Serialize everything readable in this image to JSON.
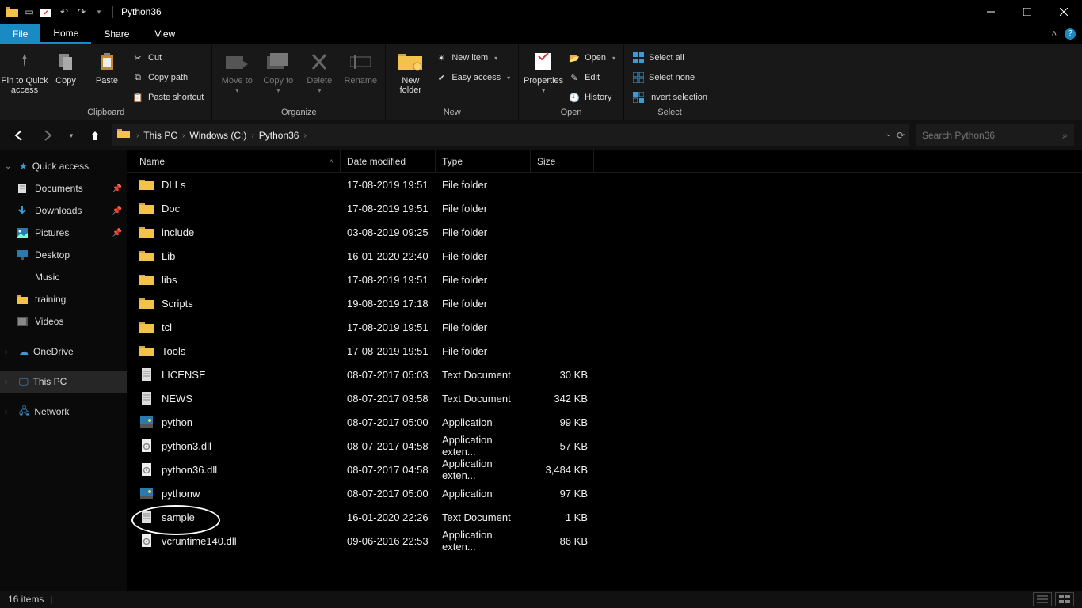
{
  "window": {
    "title": "Python36"
  },
  "menu": {
    "file": "File",
    "home": "Home",
    "share": "Share",
    "view": "View"
  },
  "ribbon": {
    "groups": {
      "clipboard": {
        "caption": "Clipboard",
        "pin": "Pin to Quick access",
        "copy": "Copy",
        "paste": "Paste",
        "cut": "Cut",
        "copypath": "Copy path",
        "pastesc": "Paste shortcut"
      },
      "organize": {
        "caption": "Organize",
        "moveto": "Move to",
        "copyto": "Copy to",
        "del": "Delete",
        "rename": "Rename"
      },
      "new": {
        "caption": "New",
        "newfolder": "New folder",
        "newitem": "New item",
        "easyaccess": "Easy access"
      },
      "open": {
        "caption": "Open",
        "properties": "Properties",
        "open": "Open",
        "edit": "Edit",
        "history": "History"
      },
      "select": {
        "caption": "Select",
        "all": "Select all",
        "none": "Select none",
        "invert": "Invert selection"
      }
    }
  },
  "breadcrumb": {
    "root": "This PC",
    "drive": "Windows (C:)",
    "folder": "Python36"
  },
  "search": {
    "placeholder": "Search Python36"
  },
  "columns": {
    "name": "Name",
    "date": "Date modified",
    "type": "Type",
    "size": "Size"
  },
  "sidebar": {
    "quick": {
      "label": "Quick access"
    },
    "items": [
      {
        "label": "Documents",
        "pinned": true,
        "icon": "doc"
      },
      {
        "label": "Downloads",
        "pinned": true,
        "icon": "down"
      },
      {
        "label": "Pictures",
        "pinned": true,
        "icon": "pic"
      },
      {
        "label": "Desktop",
        "pinned": false,
        "icon": "desk"
      },
      {
        "label": "Music",
        "pinned": false,
        "icon": "music"
      },
      {
        "label": "training",
        "pinned": false,
        "icon": "fold"
      },
      {
        "label": "Videos",
        "pinned": false,
        "icon": "vid"
      }
    ],
    "onedrive": "OneDrive",
    "thispc": "This PC",
    "network": "Network"
  },
  "files": [
    {
      "name": "DLLs",
      "date": "17-08-2019 19:51",
      "type": "File folder",
      "size": "",
      "icon": "folder"
    },
    {
      "name": "Doc",
      "date": "17-08-2019 19:51",
      "type": "File folder",
      "size": "",
      "icon": "folder"
    },
    {
      "name": "include",
      "date": "03-08-2019 09:25",
      "type": "File folder",
      "size": "",
      "icon": "folder"
    },
    {
      "name": "Lib",
      "date": "16-01-2020 22:40",
      "type": "File folder",
      "size": "",
      "icon": "folder"
    },
    {
      "name": "libs",
      "date": "17-08-2019 19:51",
      "type": "File folder",
      "size": "",
      "icon": "folder"
    },
    {
      "name": "Scripts",
      "date": "19-08-2019 17:18",
      "type": "File folder",
      "size": "",
      "icon": "folder"
    },
    {
      "name": "tcl",
      "date": "17-08-2019 19:51",
      "type": "File folder",
      "size": "",
      "icon": "folder"
    },
    {
      "name": "Tools",
      "date": "17-08-2019 19:51",
      "type": "File folder",
      "size": "",
      "icon": "folder"
    },
    {
      "name": "LICENSE",
      "date": "08-07-2017 05:03",
      "type": "Text Document",
      "size": "30 KB",
      "icon": "txt"
    },
    {
      "name": "NEWS",
      "date": "08-07-2017 03:58",
      "type": "Text Document",
      "size": "342 KB",
      "icon": "txt"
    },
    {
      "name": "python",
      "date": "08-07-2017 05:00",
      "type": "Application",
      "size": "99 KB",
      "icon": "exe"
    },
    {
      "name": "python3.dll",
      "date": "08-07-2017 04:58",
      "type": "Application exten...",
      "size": "57 KB",
      "icon": "dll"
    },
    {
      "name": "python36.dll",
      "date": "08-07-2017 04:58",
      "type": "Application exten...",
      "size": "3,484 KB",
      "icon": "dll"
    },
    {
      "name": "pythonw",
      "date": "08-07-2017 05:00",
      "type": "Application",
      "size": "97 KB",
      "icon": "exe"
    },
    {
      "name": "sample",
      "date": "16-01-2020 22:26",
      "type": "Text Document",
      "size": "1 KB",
      "icon": "txt",
      "circled": true
    },
    {
      "name": "vcruntime140.dll",
      "date": "09-06-2016 22:53",
      "type": "Application exten...",
      "size": "86 KB",
      "icon": "dll"
    }
  ],
  "status": {
    "count": "16 items"
  }
}
